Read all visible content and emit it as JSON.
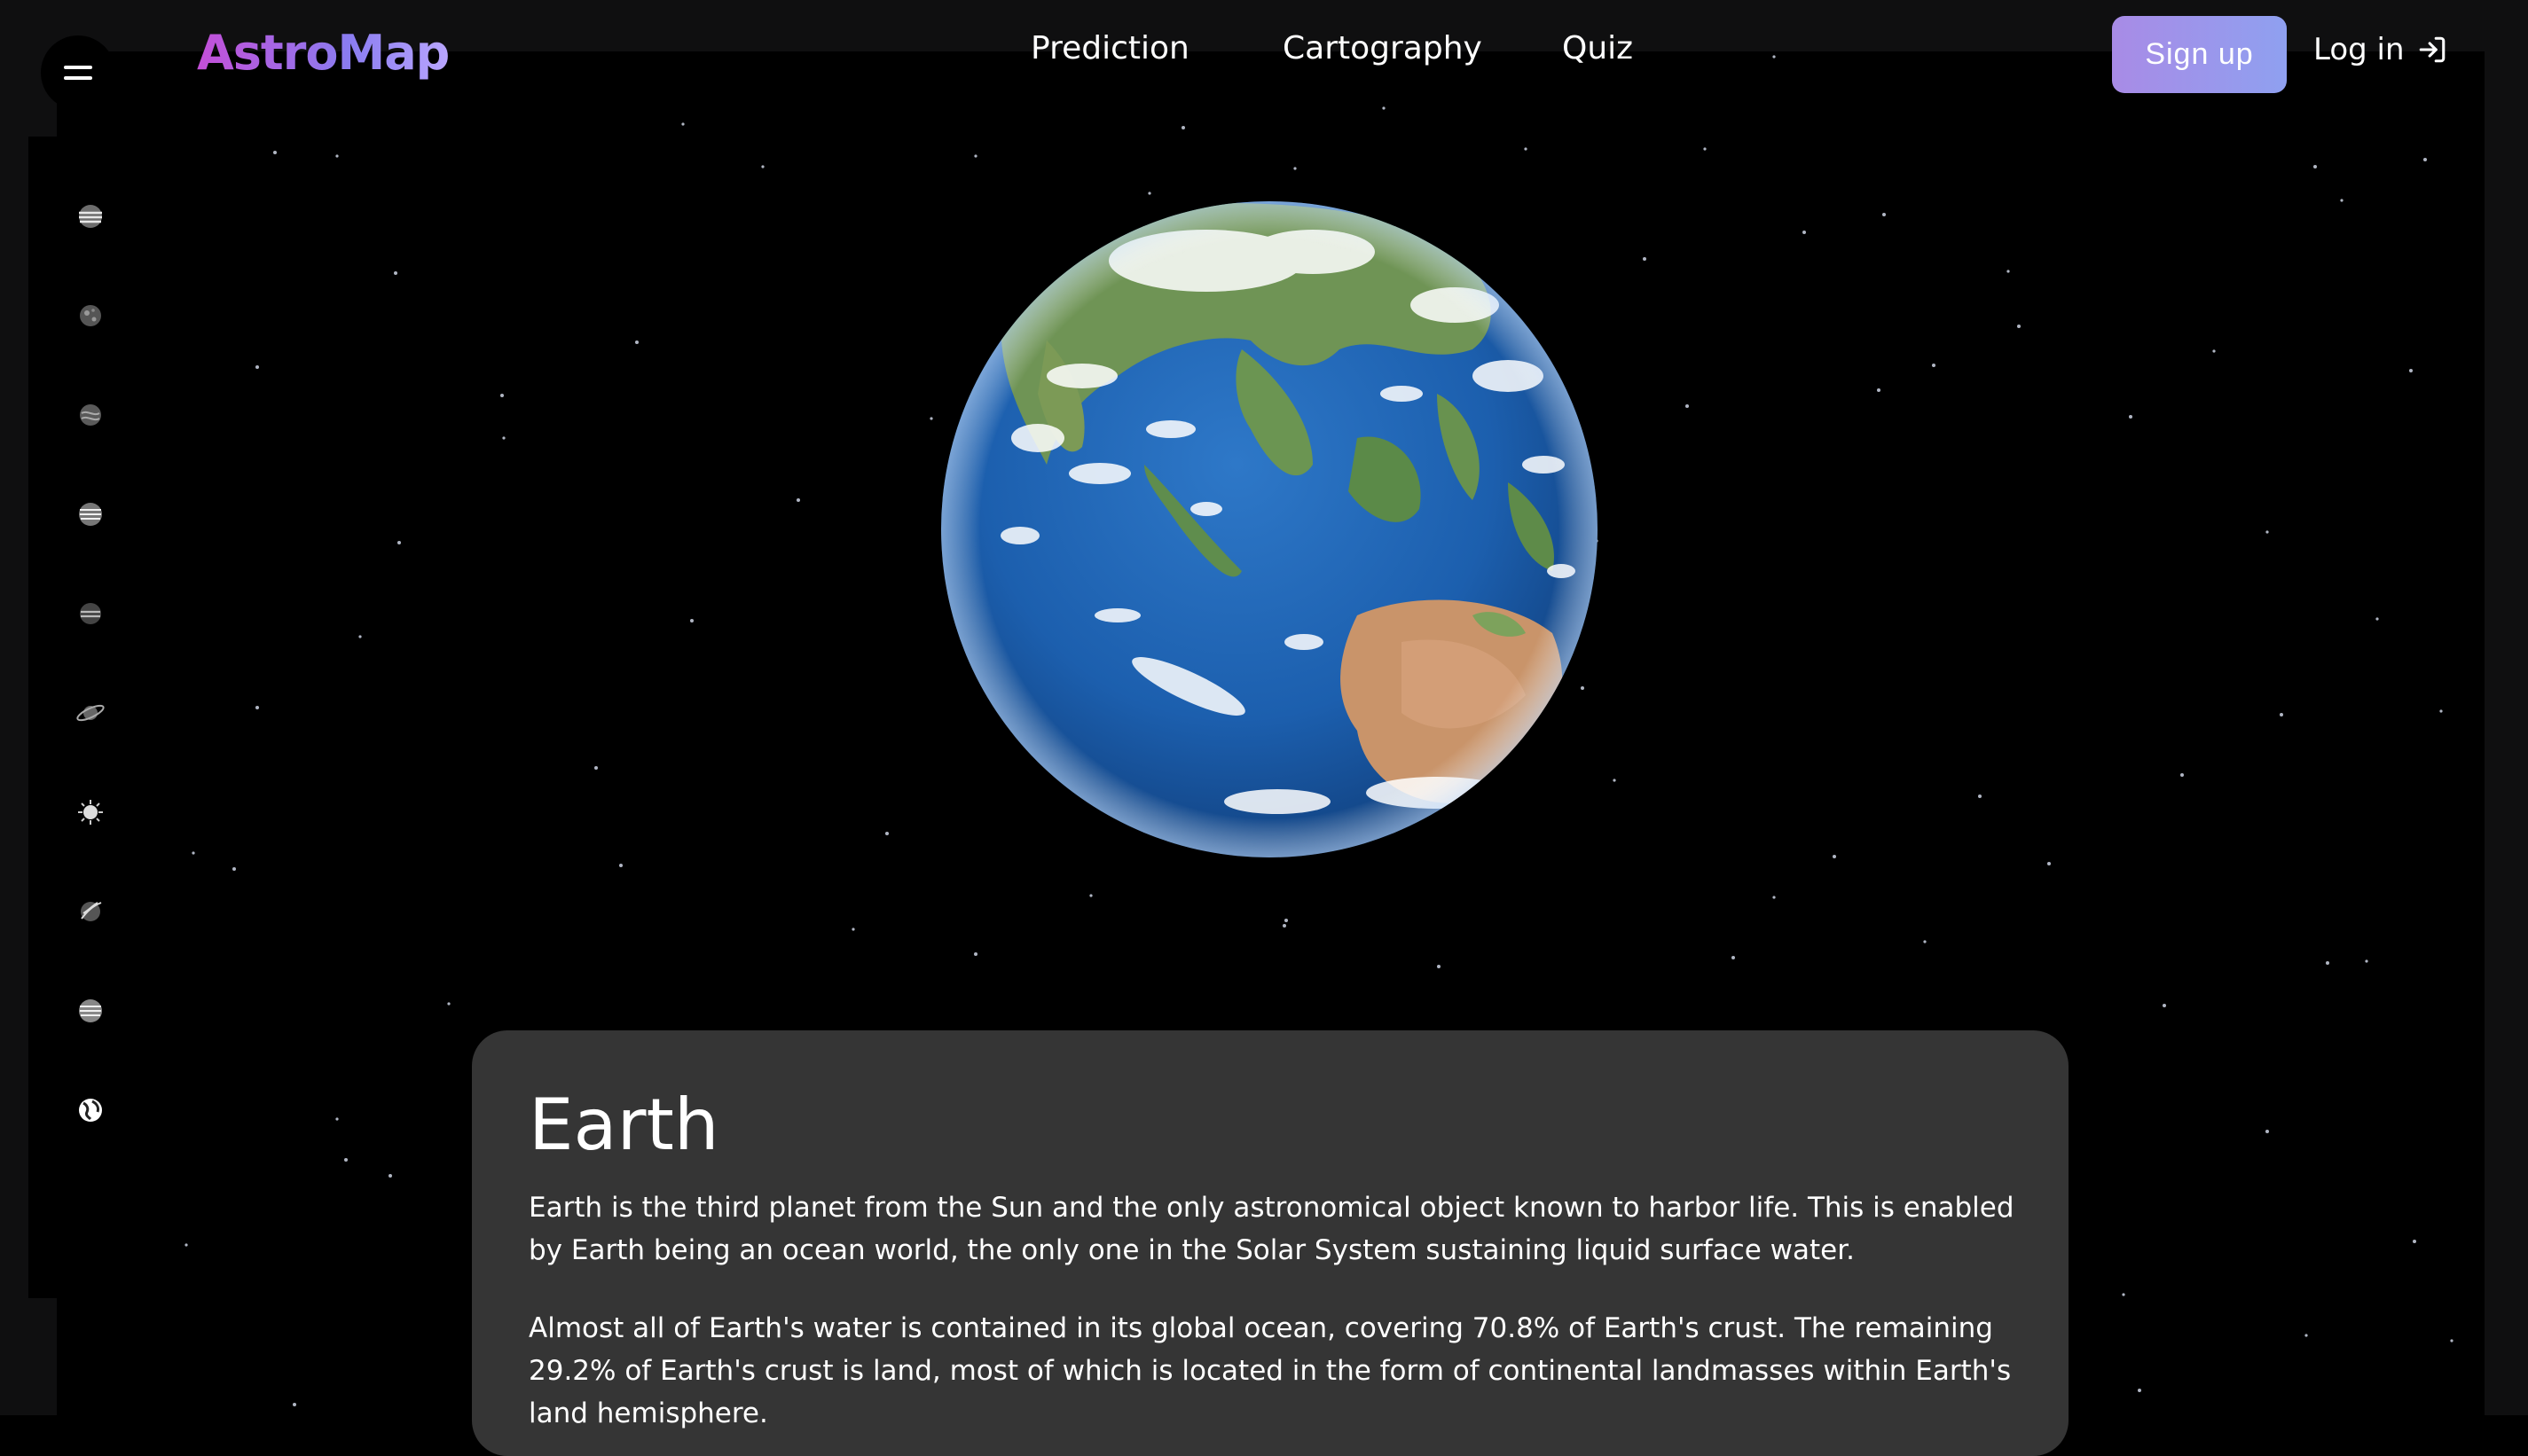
{
  "app": {
    "logo": "AstroMap"
  },
  "nav": {
    "items": [
      "Prediction",
      "Cartography",
      "Quiz"
    ]
  },
  "auth": {
    "signup_label": "Sign up",
    "login_label": "Log in",
    "login_icon": "log-in-icon"
  },
  "sidebar": {
    "menu_icon": "hamburger-icon",
    "planets": [
      {
        "icon": "jupiter-icon"
      },
      {
        "icon": "mercury-icon"
      },
      {
        "icon": "venus-icon"
      },
      {
        "icon": "neptune-icon"
      },
      {
        "icon": "uranus-icon"
      },
      {
        "icon": "saturn-icon"
      },
      {
        "icon": "sun-icon"
      },
      {
        "icon": "mars-icon"
      },
      {
        "icon": "moon-icon"
      },
      {
        "icon": "earth-icon"
      }
    ]
  },
  "planet": {
    "name": "Earth",
    "description": [
      "Earth is the third planet from the Sun and the only astronomical object known to harbor life. This is enabled by Earth being an ocean world, the only one in the Solar System sustaining liquid surface water.",
      "Almost all of Earth's water is contained in its global ocean, covering 70.8% of Earth's crust. The remaining 29.2% of Earth's crust is land, most of which is located in the form of continental landmasses within Earth's land hemisphere."
    ]
  },
  "colors": {
    "background": "#000000",
    "card": "#353535",
    "accent": "#a88be6"
  }
}
